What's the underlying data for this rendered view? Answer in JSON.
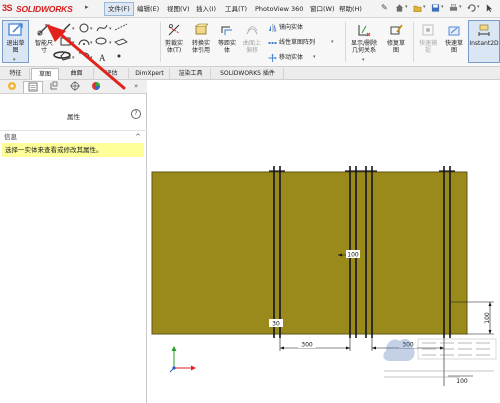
{
  "app": {
    "logo_ds": "3S",
    "logo_text": "SOLIDWORKS",
    "logo_caret": "▸"
  },
  "menu": [
    {
      "label": "文件(F)",
      "active": true
    },
    {
      "label": "编辑(E)"
    },
    {
      "label": "视图(V)"
    },
    {
      "label": "插入(I)"
    },
    {
      "label": "工具(T)"
    },
    {
      "label": "PhotoView 360"
    },
    {
      "label": "窗口(W)"
    },
    {
      "label": "帮助(H)"
    }
  ],
  "ribbon": {
    "exit_sketch": "退出草\n图",
    "smart_dim": "智能尺\n寸",
    "trim": "剪裁实\n体(T)",
    "convert": "转换实\n体引用",
    "offset": "等距实\n体",
    "surface_offset": "曲面上\n偏移",
    "mirror": "镜向实体",
    "linear_pattern": "线性草图阵列",
    "move": "移动实体",
    "display_relations": "显示/删除\n几何关系",
    "repair": "修复草\n图",
    "quick_snap": "快速捕\n捉",
    "rapid_sketch": "快速草\n图",
    "instant2d": "Instant2D"
  },
  "tabs": [
    "特征",
    "草图",
    "曲面",
    "评估",
    "DimXpert",
    "渲染工具",
    "SOLIDWORKS 插件"
  ],
  "active_tab": "草图",
  "panel": {
    "title": "属性",
    "help": "?",
    "section_title": "信息",
    "section_caret": "^",
    "message": "选择一实体来查看或修改其属性。",
    "chevron": "»"
  },
  "drawing": {
    "dims": [
      "100",
      "30",
      "300",
      "300",
      "100",
      "100"
    ]
  },
  "colors": {
    "plate": "#9a8a1c",
    "plate_edge": "#5e5410",
    "exit_sketch": "#3d7fd6",
    "arrow_red": "#e3231b",
    "logo_red": "#d71f1f",
    "message_bg": "#ffff99"
  },
  "icons": [
    "exit-sketch-icon",
    "smart-dimension-icon",
    "line-icon",
    "circle-icon",
    "trim-icon",
    "mirror-icon",
    "save-icon",
    "home-icon"
  ]
}
